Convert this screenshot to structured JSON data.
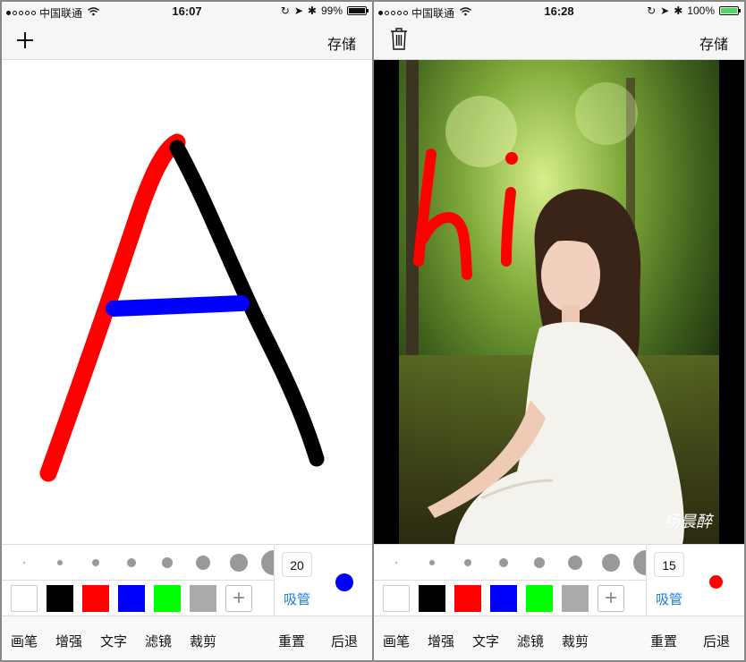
{
  "left": {
    "status": {
      "carrier": "中国联通",
      "time": "16:07",
      "battery": "99%",
      "battery_level": 0.99
    },
    "nav": {
      "save": "存储"
    },
    "stroke_size": "20",
    "eyedropper": "吸管",
    "current_color": "#0000ff"
  },
  "right": {
    "status": {
      "carrier": "中国联通",
      "time": "16:28",
      "battery": "100%",
      "battery_level": 1.0
    },
    "nav": {
      "save": "存储"
    },
    "stroke_size": "15",
    "eyedropper": "吸管",
    "current_color": "#ff0000",
    "photo_watermark": "杨晨醉",
    "drawn_text": "hi"
  },
  "palette": [
    "#ffffff",
    "#000000",
    "#ff0000",
    "#0000ff",
    "#00ff00",
    "#aaaaaa"
  ],
  "toolbar": [
    "画笔",
    "增强",
    "文字",
    "滤镜",
    "裁剪",
    "重置",
    "后退"
  ]
}
